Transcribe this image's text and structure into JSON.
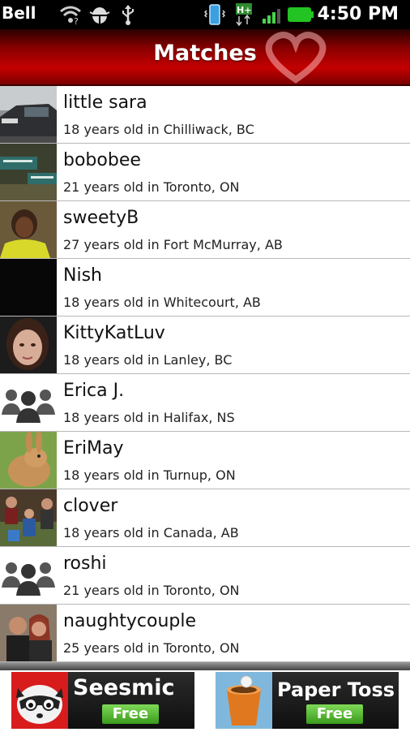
{
  "status_bar": {
    "carrier": "Bell",
    "time": "4:50 PM",
    "network": "H+",
    "icons": [
      "wifi-question-icon",
      "android-debug-icon",
      "usb-icon",
      "phone-vibrate-icon",
      "network-hplus-icon",
      "signal-icon",
      "battery-icon"
    ]
  },
  "header": {
    "title": "Matches",
    "accent_color": "#c40000"
  },
  "matches": [
    {
      "name": "little sara",
      "info": "18 years old in Chilliwack, BC",
      "photo": "car-photo"
    },
    {
      "name": "bobobee",
      "info": "21 years old in Toronto, ON",
      "photo": "street-sign-photo"
    },
    {
      "name": "sweetyB",
      "info": "27 years old in Fort McMurray, AB",
      "photo": "person-photo"
    },
    {
      "name": "Nish",
      "info": "18 years old in Whitecourt, AB",
      "photo": "dark-photo"
    },
    {
      "name": "KittyKatLuv",
      "info": "18 years old in Lanley, BC",
      "photo": "face-photo"
    },
    {
      "name": "Erica J.",
      "info": "18 years old in Halifax, NS",
      "photo": "default-avatar-icon"
    },
    {
      "name": "EriMay",
      "info": "18 years old in Turnup, ON",
      "photo": "bunny-photo"
    },
    {
      "name": "clover",
      "info": "18 years old in Canada, AB",
      "photo": "group-photo"
    },
    {
      "name": "roshi",
      "info": "21 years old in Toronto, ON",
      "photo": "default-avatar-icon"
    },
    {
      "name": "naughtycouple",
      "info": "25 years old in Toronto, ON",
      "photo": "couple-photo"
    }
  ],
  "ads": [
    {
      "title": "Seesmic",
      "badge": "Free",
      "icon": "raccoon-icon"
    },
    {
      "title": "Paper Toss",
      "badge": "Free",
      "icon": "trash-can-icon"
    }
  ]
}
